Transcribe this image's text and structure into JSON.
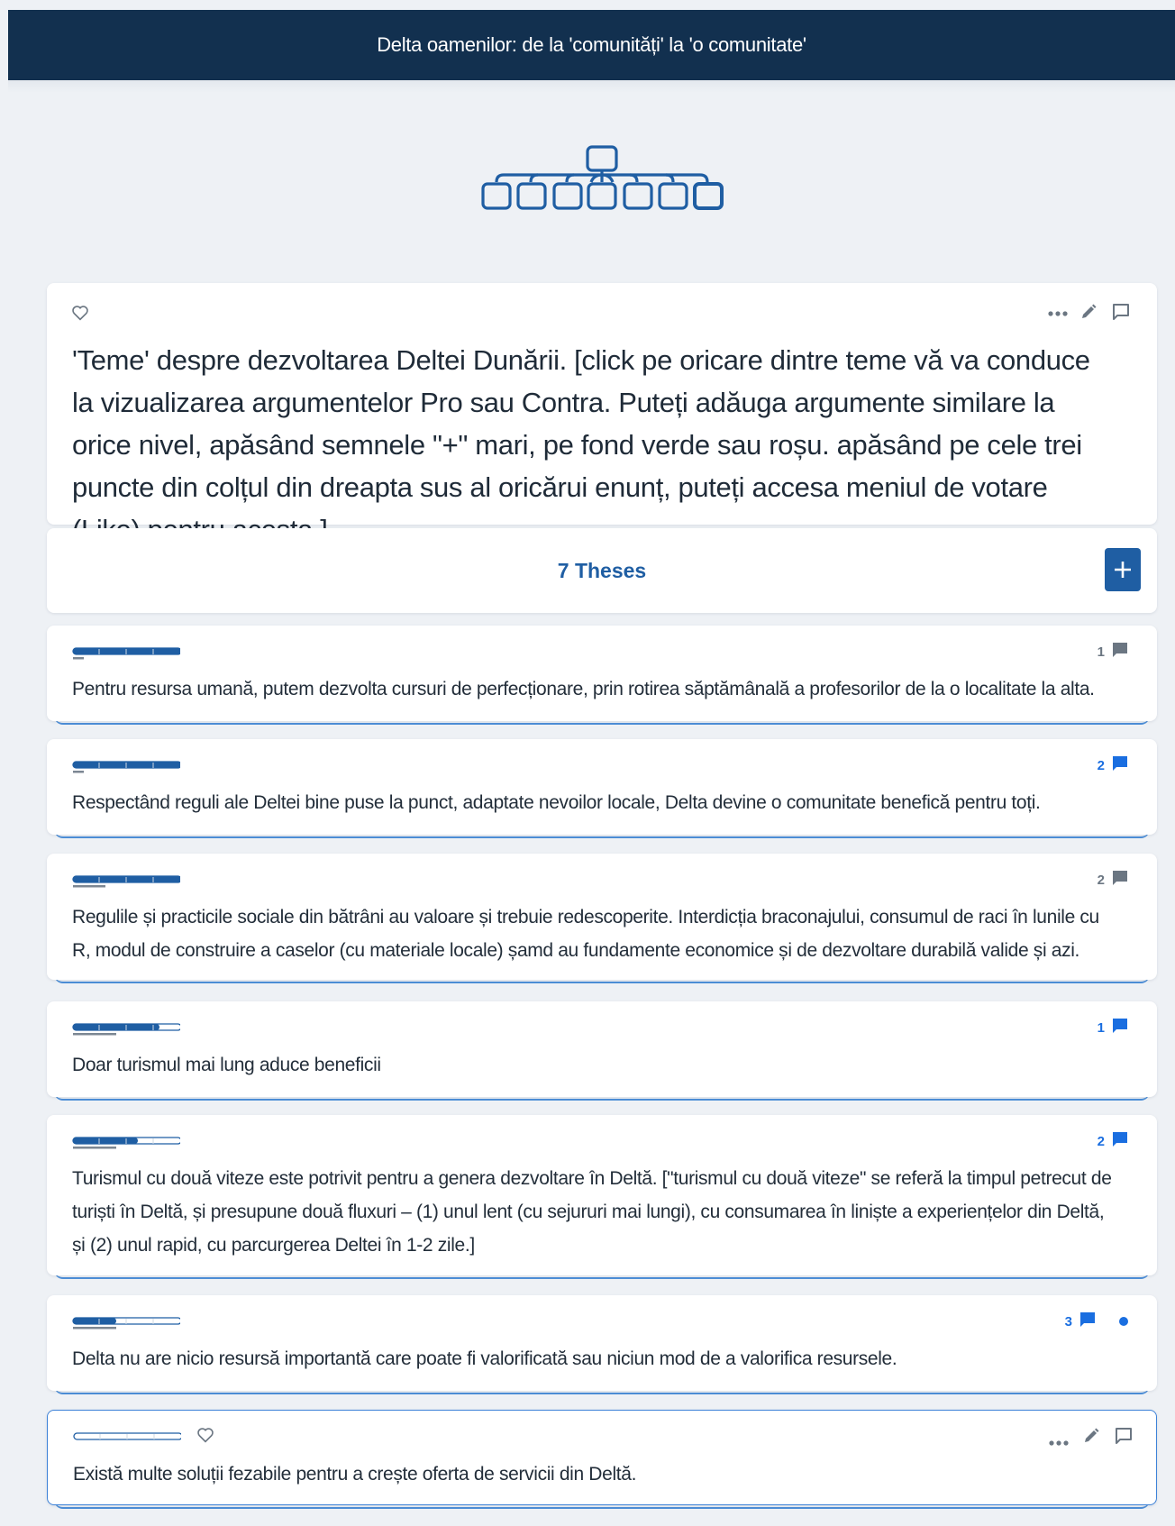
{
  "header": {
    "title": "Delta oamenilor: de la 'comunități' la 'o comunitate'"
  },
  "colors": {
    "header_bg": "#12304f",
    "accent": "#1f5ea3",
    "comment_active": "#1a6ee0",
    "comment_inactive": "#6b7682"
  },
  "intro": {
    "text": "'Teme' despre dezvoltarea Deltei Dunării. [click pe oricare dintre teme vă va conduce la vizualizarea argumentelor Pro sau Contra. Puteți adăuga argumente similare la orice nivel, apăsând semnele \"+\" mari, pe fond verde sau roșu. apăsând pe cele trei puncte din colțul din dreapta sus al oricărui enunț, puteți accesa meniul de votare (Like) pentru acesta.]",
    "icons": [
      "heart-icon",
      "more-icon",
      "edit-icon",
      "comment-icon"
    ]
  },
  "theses_bar": {
    "label": "7 Theses",
    "add_icon": "plus-icon"
  },
  "theses": [
    {
      "text": "Pentru resursa umană, putem dezvolta cursuri de perfecționare, prin rotirea săptămânală a profesorilor de la o localitate la alta.",
      "comments": "1",
      "comments_active": false,
      "rating": 1.0,
      "confidence": 0.1
    },
    {
      "text": "Respectând reguli ale Deltei bine puse la punct, adaptate nevoilor locale, Delta devine o comunitate benefică pentru toți.",
      "comments": "2",
      "comments_active": true,
      "rating": 1.0,
      "confidence": 0.1
    },
    {
      "text": "Regulile și practicile sociale din bătrâni au valoare și trebuie redescoperite. Interdicția braconajului, consumul de raci în lunile cu R, modul de construire a caselor (cu materiale locale) șamd au fundamente economice și de dezvoltare durabilă valide și azi.",
      "comments": "2",
      "comments_active": false,
      "rating": 1.0,
      "confidence": 0.3
    },
    {
      "text": "Doar turismul mai lung aduce beneficii",
      "comments": "1",
      "comments_active": true,
      "rating": 0.8,
      "confidence": 0.4
    },
    {
      "text": "Turismul cu două viteze este potrivit pentru a genera dezvoltare în Deltă. [\"turismul cu două viteze\" se referă la timpul petrecut de turiști în Deltă, și presupune două fluxuri – (1) unul lent (cu sejururi mai lungi), cu consumarea în liniște a experiențelor din Deltă, și (2) unul rapid, cu parcurgerea Deltei în 1-2 zile.]",
      "comments": "2",
      "comments_active": true,
      "rating": 0.6,
      "confidence": 0.4
    },
    {
      "text": "Delta nu are nicio resursă importantă care poate fi valorificată sau niciun mod de a valorifica resursele.",
      "comments": "3",
      "comments_active": true,
      "rating": 0.4,
      "confidence": 0.4,
      "unread": true
    },
    {
      "text": "Există multe soluții fezabile pentru a crește oferta de servicii din Deltă.",
      "comments": "",
      "comments_active": false,
      "rating": 0.0,
      "confidence": 0.0,
      "selected": true
    }
  ]
}
